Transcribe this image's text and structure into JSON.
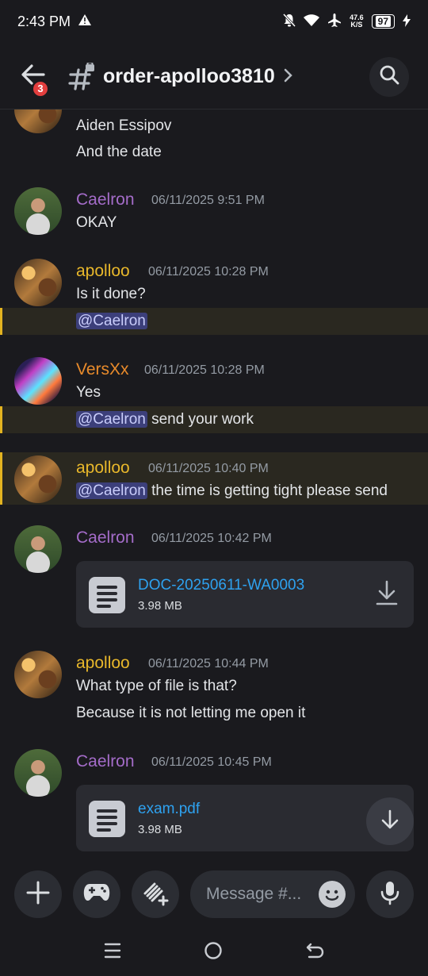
{
  "status": {
    "time": "2:43 PM",
    "net_speed": "47.6",
    "net_unit": "K/S",
    "battery": "97"
  },
  "header": {
    "back_badge": "3",
    "channel_name": "order-apolloo3810"
  },
  "messages": [
    {
      "user": "",
      "time": "",
      "lines": [
        "Aiden Essipov",
        "And the date"
      ]
    },
    {
      "user": "Caelron",
      "time": "06/11/2025 9:51 PM",
      "lines": [
        "OKAY"
      ]
    },
    {
      "user": "apolloo",
      "time": "06/11/2025 10:28 PM",
      "lines": [
        "Is it done?"
      ],
      "mention": "@Caelron"
    },
    {
      "user": "VersXx",
      "time": "06/11/2025 10:28 PM",
      "lines": [
        "Yes"
      ],
      "mention": "@Caelron",
      "mention_text": "send your work"
    },
    {
      "user": "apolloo",
      "time": "06/11/2025 10:40 PM",
      "mention": "@Caelron",
      "mention_text": "the time is getting tight please send"
    },
    {
      "user": "Caelron",
      "time": "06/11/2025 10:42 PM",
      "file": {
        "name": "DOC-20250611-WA0003",
        "size": "3.98 MB"
      }
    },
    {
      "user": "apolloo",
      "time": "06/11/2025 10:44 PM",
      "lines": [
        "What type of file is that?",
        "Because it is not letting me open it"
      ]
    },
    {
      "user": "Caelron",
      "time": "06/11/2025 10:45 PM",
      "file": {
        "name": "exam.pdf",
        "size": "3.98 MB"
      }
    }
  ],
  "composer": {
    "placeholder": "Message #..."
  },
  "colors": {
    "caelron": "#a46cc9",
    "apolloo": "#e9b82b",
    "versxx": "#e98b2b",
    "link": "#2ea2f0",
    "highlight_bar": "#e3b320"
  }
}
